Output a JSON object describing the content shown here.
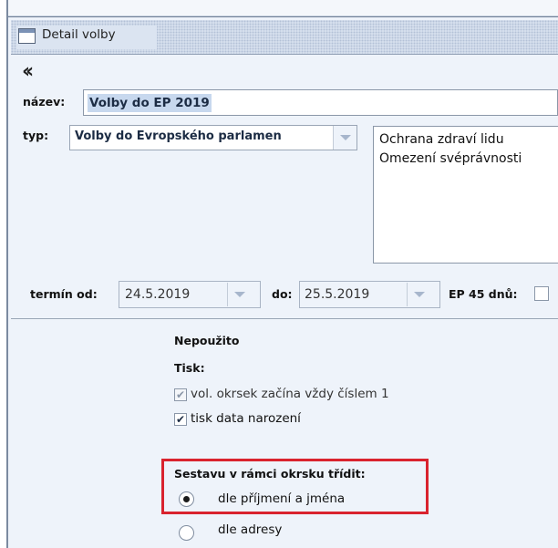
{
  "window": {
    "title": "Detail volby"
  },
  "form": {
    "name_label": "název:",
    "name_value": "Volby do EP 2019",
    "type_label": "typ:",
    "type_value": "Volby do Evropského parlamen",
    "reasons": [
      "Ochrana zdraví lidu",
      "Omezení svéprávnosti"
    ],
    "date_from_label": "termín od:",
    "date_from_value": "24.5.2019",
    "date_to_label": "do:",
    "date_to_value": "25.5.2019",
    "ep45_label": "EP 45 dnů:",
    "ep45_checked": false
  },
  "options": {
    "unused_label": "Nepoužito",
    "print_label": "Tisk:",
    "checkboxes": [
      {
        "label": "vol. okrsek začína vždy číslem 1",
        "checked": true,
        "enabled": false
      },
      {
        "label": "tisk data narození",
        "checked": true,
        "enabled": true
      }
    ],
    "sort_label": "Sestavu v rámci okrsku třídit:",
    "radios": [
      {
        "label": "dle příjmení a jména",
        "selected": true
      },
      {
        "label": "dle adresy",
        "selected": false
      }
    ]
  },
  "colors": {
    "highlight": "#d9232e",
    "panel_bg": "#eef3fa"
  }
}
